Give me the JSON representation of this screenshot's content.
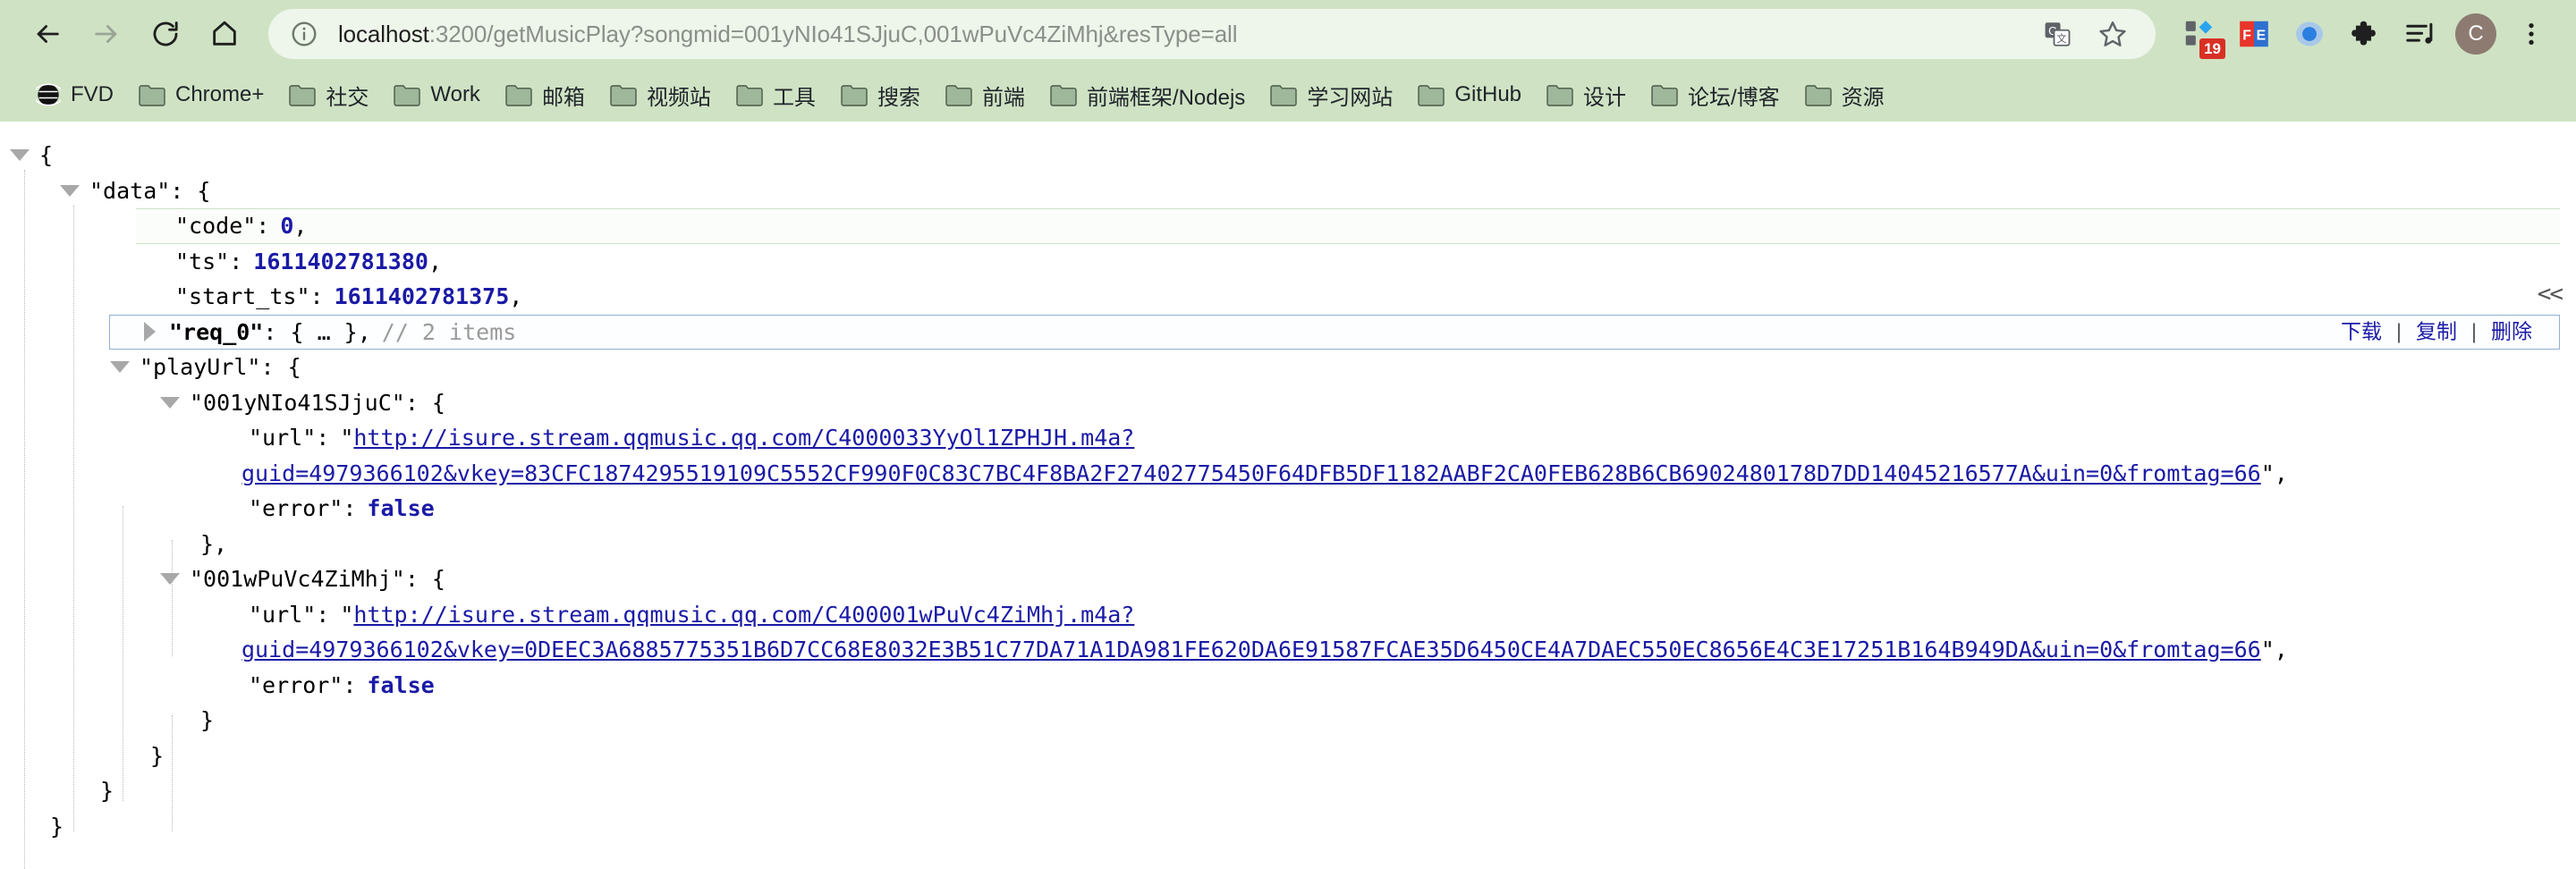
{
  "browser": {
    "nav": {
      "back_label": "Back",
      "forward_label": "Forward",
      "reload_label": "Reload",
      "home_label": "Home"
    },
    "omnibox": {
      "info_icon": "info-circle-icon",
      "url_host": "localhost",
      "url_rest": ":3200/getMusicPlay?songmid=001yNIo41SJjuC,001wPuVc4ZiMhj&resType=all",
      "url_full": "localhost:3200/getMusicPlay?songmid=001yNIo41SJjuC,001wPuVc4ZiMhj&resType=all",
      "translate_icon": "translate-icon",
      "bookmark_icon": "star-icon"
    },
    "toolbar_icons": [
      {
        "name": "extensions-grid-icon",
        "badge": "19"
      },
      {
        "name": "fe-extension-icon",
        "label": "FE"
      },
      {
        "name": "blue-circle-extension-icon"
      },
      {
        "name": "puzzle-extensions-icon"
      },
      {
        "name": "media-playlist-icon"
      }
    ],
    "profile": {
      "initial": "C",
      "color": "#8d7b72"
    },
    "menu_icon": "three-dot-menu-icon",
    "theme_color": "#cfe3c4"
  },
  "bookmarks": [
    {
      "label": "FVD",
      "icon": "globe-icon"
    },
    {
      "label": "Chrome+",
      "icon": "folder-icon"
    },
    {
      "label": "社交",
      "icon": "folder-icon"
    },
    {
      "label": "Work",
      "icon": "folder-icon"
    },
    {
      "label": "邮箱",
      "icon": "folder-icon"
    },
    {
      "label": "视频站",
      "icon": "folder-icon"
    },
    {
      "label": "工具",
      "icon": "folder-icon"
    },
    {
      "label": "搜索",
      "icon": "folder-icon"
    },
    {
      "label": "前端",
      "icon": "folder-icon"
    },
    {
      "label": "前端框架/Nodejs",
      "icon": "folder-icon"
    },
    {
      "label": "学习网站",
      "icon": "folder-icon"
    },
    {
      "label": "GitHub",
      "icon": "folder-icon"
    },
    {
      "label": "设计",
      "icon": "folder-icon"
    },
    {
      "label": "论坛/博客",
      "icon": "folder-icon"
    },
    {
      "label": "资源",
      "icon": "folder-icon"
    }
  ],
  "viewer": {
    "collapse_all_label": "<<",
    "row_actions": {
      "download": "下载",
      "copy": "复制",
      "delete": "删除",
      "separator": "|"
    }
  },
  "json": {
    "open_root": "{",
    "close_root": "}",
    "data_key": "\"data\": {",
    "code_key": "\"code\":",
    "code_value": "0",
    "code_comma": ",",
    "ts_key": "\"ts\":",
    "ts_value": "1611402781380",
    "ts_comma": ",",
    "start_ts_key": "\"start_ts\":",
    "start_ts_value": "1611402781375",
    "start_ts_comma": ",",
    "req0_key": "\"req_0\"",
    "req0_value": ": { … },",
    "req0_comment": "// 2 items",
    "playurl_key": "\"playUrl\": {",
    "entries": [
      {
        "songmid": "\"001yNIo41SJjuC\": {",
        "url_key": "\"url\":",
        "url_open_quote": "\"",
        "url_line1": "http://isure.stream.qqmusic.qq.com/C4000033YyOl1ZPHJH.m4a?",
        "url_line2": "guid=4979366102&vkey=83CFC1874295519109C5552CF990F0C83C7BC4F8BA2F27402775450F64DFB5DF1182AABF2CA0FEB628B6CB6902480178D7DD14045216577A&uin=0&fromtag=66",
        "url_close": "\",",
        "error_key": "\"error\":",
        "error_value": "false",
        "close_brace": "},"
      },
      {
        "songmid": "\"001wPuVc4ZiMhj\": {",
        "url_key": "\"url\":",
        "url_open_quote": "\"",
        "url_line1": "http://isure.stream.qqmusic.qq.com/C400001wPuVc4ZiMhj.m4a?",
        "url_line2": "guid=4979366102&vkey=0DEEC3A6885775351B6D7CC68E8032E3B51C77DA71A1DA981FE620DA6E91587FCAE35D6450CE4A7DAEC550EC8656E4C3E17251B164B949DA&uin=0&fromtag=66",
        "url_close": "\",",
        "error_key": "\"error\":",
        "error_value": "false",
        "close_brace": "}"
      }
    ],
    "close_playurl": "}",
    "close_data": "}"
  }
}
